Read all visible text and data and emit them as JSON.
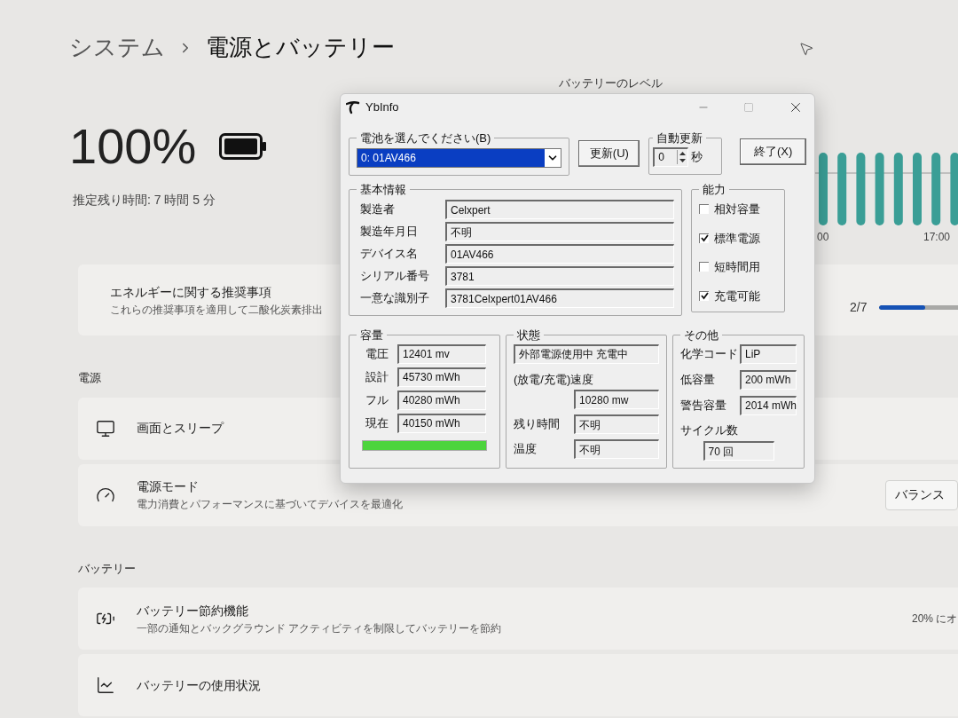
{
  "settings": {
    "breadcrumb": {
      "parent": "システム",
      "current": "電源とバッテリー"
    },
    "charge": "100%",
    "estimate": "推定残り時間: 7 時間 5 分",
    "chart": {
      "title": "バッテリーのレベル",
      "time_labels": [
        "00",
        "17:00"
      ]
    },
    "energy_card": {
      "title": "エネルギーに関する推奨事項",
      "description": "これらの推奨事項を適用して二酸化炭素排出",
      "count": "2/7",
      "level": 0.4
    },
    "sections": [
      {
        "heading": "電源",
        "cards": [
          {
            "title": "画面とスリープ"
          },
          {
            "title": "電源モード",
            "description": "電力消費とパフォーマンスに基づいてデバイスを最適化",
            "action": {
              "kind": "button",
              "label": "バランス"
            }
          }
        ]
      },
      {
        "heading": "バッテリー",
        "cards": [
          {
            "title": "バッテリー節約機能",
            "description": "一部の通知とバックグラウンド アクティビティを制限してバッテリーを節約",
            "action": {
              "kind": "text",
              "label": "20% にオ"
            }
          },
          {
            "title": "バッテリーの使用状況"
          }
        ]
      }
    ]
  },
  "dialog": {
    "title": "YbInfo",
    "battery_select": {
      "label": "電池を選んでください(B)",
      "value": "0: 01AV466"
    },
    "refresh_button": "更新(U)",
    "auto_update": {
      "label": "自動更新",
      "value": "0",
      "unit": "秒"
    },
    "exit_button": "終了(X)",
    "basic_info": {
      "title": "基本情報",
      "fields": [
        {
          "label": "製造者",
          "value": "Celxpert"
        },
        {
          "label": "製造年月日",
          "value": "不明"
        },
        {
          "label": "デバイス名",
          "value": "01AV466"
        },
        {
          "label": "シリアル番号",
          "value": "3781"
        },
        {
          "label": "一意な識別子",
          "value": "3781Celxpert01AV466"
        }
      ]
    },
    "capabilities": {
      "title": "能力",
      "items": [
        {
          "label": "相対容量",
          "checked": false
        },
        {
          "label": "標準電源",
          "checked": true
        },
        {
          "label": "短時間用",
          "checked": false
        },
        {
          "label": "充電可能",
          "checked": true
        }
      ]
    },
    "capacity": {
      "title": "容量",
      "fields": [
        {
          "label": "電圧",
          "value": "12401 mv"
        },
        {
          "label": "設計",
          "value": "45730 mWh"
        },
        {
          "label": "フル",
          "value": "40280 mWh"
        },
        {
          "label": "現在",
          "value": "40150 mWh"
        }
      ],
      "level": 1
    },
    "status": {
      "title": "状態",
      "state": "外部電源使用中 充電中",
      "rate_label": "(放電/充電)速度",
      "rate": "10280 mw",
      "fields": [
        {
          "label": "残り時間",
          "value": "不明"
        },
        {
          "label": "温度",
          "value": "不明"
        }
      ]
    },
    "other": {
      "title": "その他",
      "fields": [
        {
          "label": "化学コード",
          "value": "LiP"
        },
        {
          "label": "低容量",
          "value": "200 mWh"
        },
        {
          "label": "警告容量",
          "value": "2014 mWh"
        }
      ],
      "cycle_label": "サイクル数",
      "cycles": "70 回"
    }
  }
}
